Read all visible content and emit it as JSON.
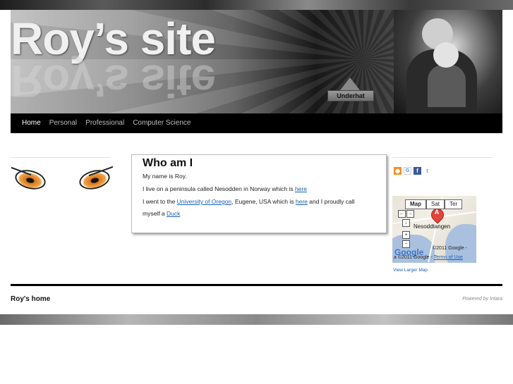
{
  "header": {
    "site_title": "Roy’s site",
    "underhat_label": "Underhat"
  },
  "nav": {
    "items": [
      {
        "label": "Home",
        "active": true
      },
      {
        "label": "Personal",
        "active": false
      },
      {
        "label": "Professional",
        "active": false
      },
      {
        "label": "Computer Science",
        "active": false
      }
    ]
  },
  "content": {
    "heading": "Who am I",
    "line1": "My name is Roy.",
    "line2_pre": "I live on a peninsula called Nesodden in Norway which is ",
    "line2_link": "here",
    "line3_pre": "I went to the ",
    "line3_link_univ": "University of Oregon",
    "line3_mid": ", Eugene, USA which is ",
    "line3_link_here": "here",
    "line3_post": " and I proudly call",
    "line4_pre": "myself a ",
    "line4_link": "Duck"
  },
  "social": {
    "icons": [
      "rss-icon",
      "google-icon",
      "facebook-icon",
      "twitter-icon"
    ]
  },
  "map": {
    "tabs": [
      "Map",
      "Sat",
      "Ter"
    ],
    "marker_letter": "A",
    "place": "Nesoddtangen",
    "google": "Google",
    "copyright": "©2011 Google -",
    "copyright2": "a ©2011 Google -",
    "terms": "Terms of Use",
    "view_larger": "View Larger Map"
  },
  "footer": {
    "home_label": "Roy's home",
    "powered_label": "Powered by Intara"
  },
  "colors": {
    "nav_bg": "#000000",
    "link": "#1a5fb4",
    "eye_orange": "#f4a64a"
  }
}
